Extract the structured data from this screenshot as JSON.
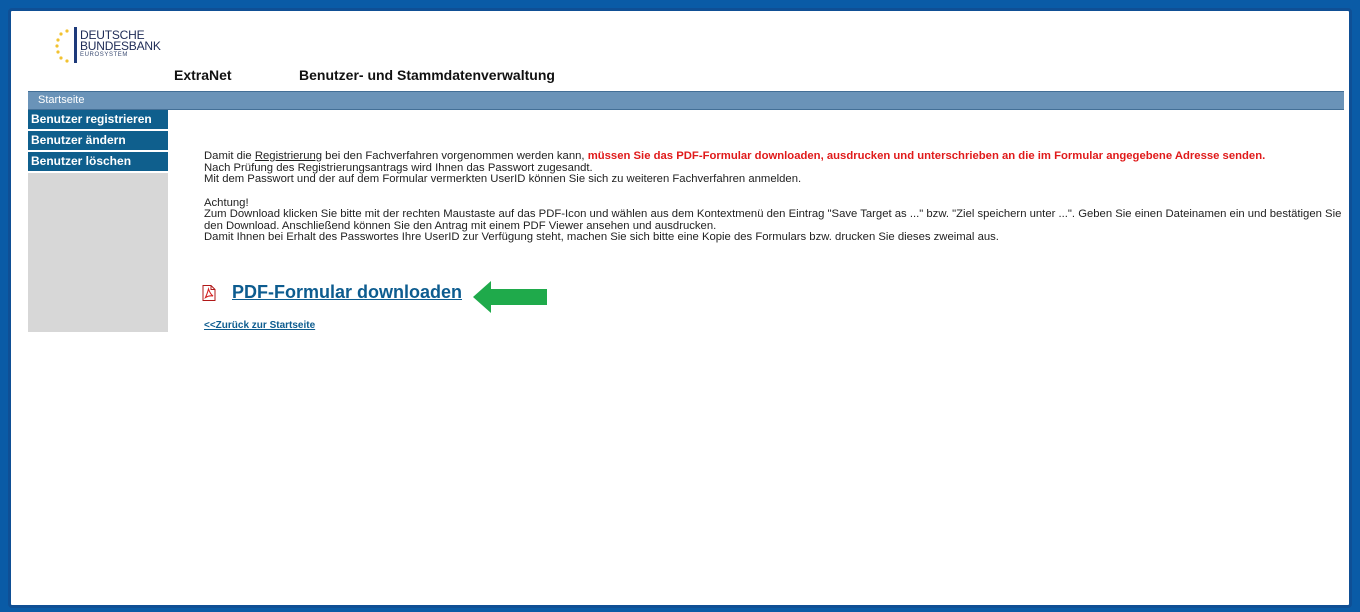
{
  "logo": {
    "line1": "DEUTSCHE",
    "line2": "BUNDESBANK",
    "line3": "EUROSYSTEM",
    "icon": "eurosystem-stars-icon"
  },
  "header": {
    "app_name": "ExtraNet",
    "title": "Benutzer- und Stammdatenverwaltung"
  },
  "navbar": {
    "home_label": "Startseite"
  },
  "sidebar": {
    "items": [
      {
        "label": "Benutzer registrieren"
      },
      {
        "label": "Benutzer ändern"
      },
      {
        "label": "Benutzer löschen"
      }
    ]
  },
  "content": {
    "p1_before": "Damit die ",
    "p1_link": "Registrierung",
    "p1_middle": " bei den Fachverfahren vorgenommen werden kann, ",
    "p1_red": "müssen Sie das PDF-Formular downloaden, ausdrucken und unterschrieben an die im Formular angegebene Adresse senden.",
    "p2": "Nach Prüfung des Registrierungsantrags wird Ihnen das Passwort zugesandt.",
    "p3": "Mit dem Passwort und der auf dem Formular vermerkten UserID können Sie sich zu weiteren Fachverfahren anmelden.",
    "warning_title": "Achtung!",
    "warning_text": "Zum Download klicken Sie bitte mit der rechten Maustaste auf das PDF-Icon und wählen aus dem Kontextmenü den Eintrag \"Save Target as ...\" bzw. \"Ziel speichern unter ...\". Geben Sie einen Dateinamen ein und bestätigen Sie den Download. Anschließend können Sie den Antrag mit einem PDF Viewer ansehen und ausdrucken.",
    "warning_text2": "Damit Ihnen bei Erhalt des Passwortes Ihre UserID zur Verfügung steht, machen Sie sich bitte eine Kopie des Formulars bzw. drucken Sie dieses zweimal aus.",
    "download_label": "PDF-Formular downloaden",
    "download_icon": "pdf-icon",
    "back_label": "<<Zurück zur Startseite"
  },
  "annotation": {
    "icon": "green-arrow-icon",
    "color": "#1faa4b"
  },
  "colors": {
    "border": "#0f4f95",
    "navbar": "#6a93b8",
    "menu": "#0f5f8d",
    "sidebar_bg": "#d7d7d7",
    "highlight_red": "#e01a1a",
    "link": "#0d5c8f"
  }
}
